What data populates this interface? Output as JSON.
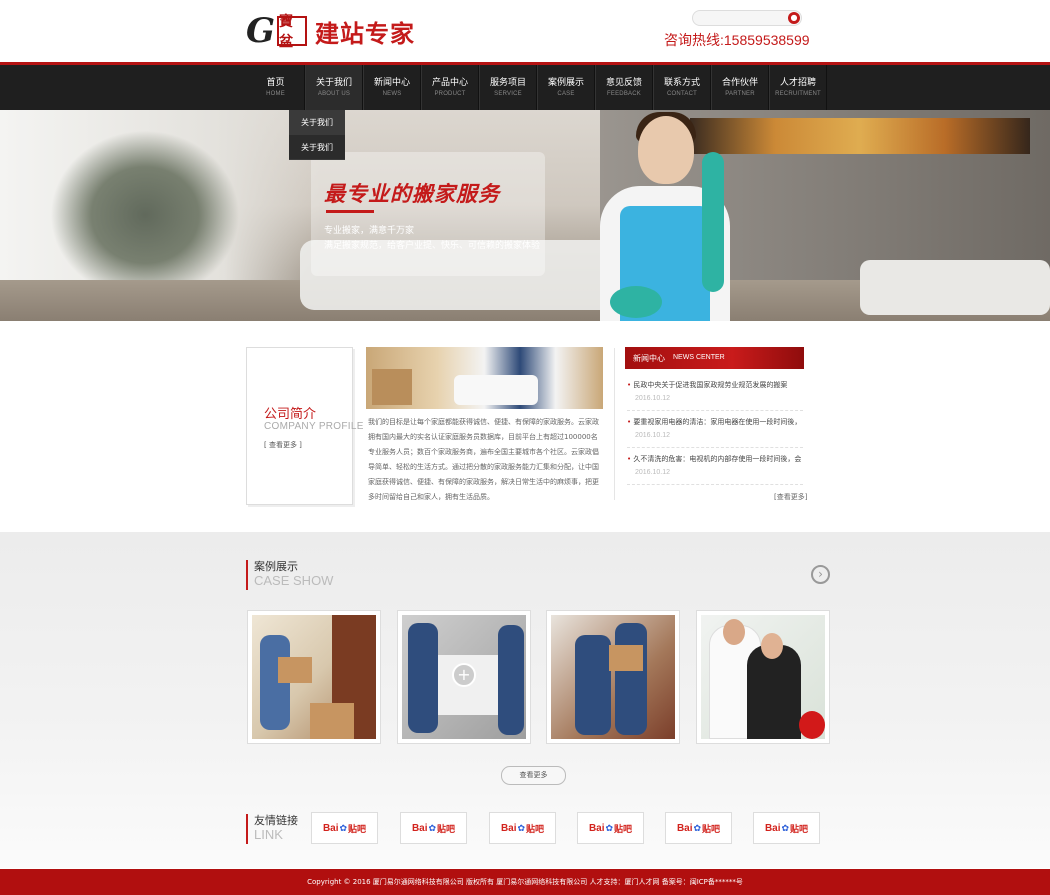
{
  "header": {
    "logo_g": "G",
    "logo_seal": "寶盆",
    "logo_text": "建站专家",
    "search_placeholder": "",
    "search_icon": "search-icon",
    "hotline": "咨询热线:15859538599"
  },
  "nav": {
    "items": [
      {
        "cn": "首页",
        "en": "HOME"
      },
      {
        "cn": "关于我们",
        "en": "ABOUT US"
      },
      {
        "cn": "新闻中心",
        "en": "NEWS"
      },
      {
        "cn": "产品中心",
        "en": "PRODUCT"
      },
      {
        "cn": "服务项目",
        "en": "SERVICE"
      },
      {
        "cn": "案例展示",
        "en": "CASE"
      },
      {
        "cn": "意见反馈",
        "en": "FEEDBACK"
      },
      {
        "cn": "联系方式",
        "en": "CONTACT"
      },
      {
        "cn": "合作伙伴",
        "en": "PARTNER"
      },
      {
        "cn": "人才招聘",
        "en": "RECRUITMENT"
      }
    ],
    "dropdown": [
      "关于我们",
      "关于我们"
    ]
  },
  "banner": {
    "title": "最专业的搬家服务",
    "line1": "专业搬家，满意千万家",
    "line2": "满足搬家规范，给客户业提、快乐、可信赖的搬家体验"
  },
  "profile": {
    "cn": "公司简介",
    "en": "COMPANY PROFILE",
    "more": "[ 查看更多 ]",
    "text": "我们的目标是让每个家庭都能获得诚信、便捷、有保障的家政服务。云家政拥有国内最大的实名认证家庭服务员数据库，目前平台上有超过100000名专业服务人员；数百个家政服务商，遍布全国主要城市各个社区。云家政倡导简单、轻松的生活方式。通过把分散的家政服务能力汇集和分配，让中国家庭获得诚信、便捷、有保障的家政服务，解决日常生活中的麻烦事，把更多时间留给自己和家人，拥有生活品质。"
  },
  "news": {
    "head_cn": "新闻中心",
    "head_en": "NEWS CENTER",
    "items": [
      {
        "title": "民政中央关于促进我国家政规劳业规范发展的搬案",
        "date": "2016.10.12"
      },
      {
        "title": "要重视家用电器的清洁：家用电器在使用一段时间後，",
        "date": "2016.10.12"
      },
      {
        "title": "久不清洗的危害：电视机的内部存使用一段时间後，会",
        "date": "2016.10.12"
      }
    ],
    "more": "[查看更多]"
  },
  "cases": {
    "cn": "案例展示",
    "en": "CASE SHOW",
    "more": "查看更多",
    "next_icon": "chevron-right-icon"
  },
  "links": {
    "cn": "友情链接",
    "en": "LINK",
    "items": [
      {
        "bai": "Bai",
        "paw": "✿",
        "tie": "贴吧"
      },
      {
        "bai": "Bai",
        "paw": "✿",
        "tie": "贴吧"
      },
      {
        "bai": "Bai",
        "paw": "✿",
        "tie": "贴吧"
      },
      {
        "bai": "Bai",
        "paw": "✿",
        "tie": "贴吧"
      },
      {
        "bai": "Bai",
        "paw": "✿",
        "tie": "贴吧"
      },
      {
        "bai": "Bai",
        "paw": "✿",
        "tie": "贴吧"
      }
    ]
  },
  "footer": {
    "text": "Copyright © 2016 厦门易尔通网络科技有限公司 版权所有 厦门易尔通网络科技有限公司 人才支持：厦门人才网 备案号：闽ICP备******号"
  },
  "colors": {
    "brand_red": "#c41a1a",
    "nav_bg": "#1f1f1f",
    "footer_red": "#b10f0f"
  }
}
